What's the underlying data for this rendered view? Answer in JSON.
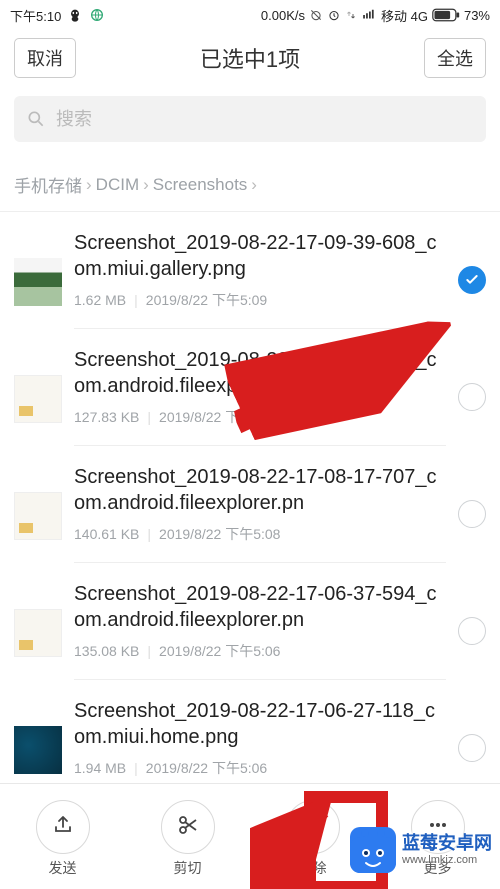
{
  "statusbar": {
    "time": "下午5:10",
    "speed": "0.00K/s",
    "carrier": "移动 4G",
    "battery_pct": "73%"
  },
  "topbar": {
    "cancel": "取消",
    "title": "已选中1项",
    "select_all": "全选"
  },
  "search": {
    "placeholder": "搜索"
  },
  "breadcrumb": {
    "seg1": "手机存储",
    "seg2": "DCIM",
    "seg3": "Screenshots"
  },
  "files": [
    {
      "name": "Screenshot_2019-08-22-17-09-39-608_com.miui.gallery.png",
      "size": "1.62 MB",
      "date": "2019/8/22 下午5:09",
      "selected": true
    },
    {
      "name": "Screenshot_2019-08-22-17-08-22-421_com.android.fileexplorer.pn",
      "size": "127.83 KB",
      "date": "2019/8/22 下午5:08",
      "selected": false
    },
    {
      "name": "Screenshot_2019-08-22-17-08-17-707_com.android.fileexplorer.pn",
      "size": "140.61 KB",
      "date": "2019/8/22 下午5:08",
      "selected": false
    },
    {
      "name": "Screenshot_2019-08-22-17-06-37-594_com.android.fileexplorer.pn",
      "size": "135.08 KB",
      "date": "2019/8/22 下午5:06",
      "selected": false
    },
    {
      "name": "Screenshot_2019-08-22-17-06-27-118_com.miui.home.png",
      "size": "1.94 MB",
      "date": "2019/8/22 下午5:06",
      "selected": false
    }
  ],
  "bottombar": {
    "send": "发送",
    "cut": "剪切",
    "delete": "删除",
    "more": "更多"
  },
  "watermark": {
    "brand": "蓝莓安卓网",
    "url": "www.lmkjz.com"
  }
}
